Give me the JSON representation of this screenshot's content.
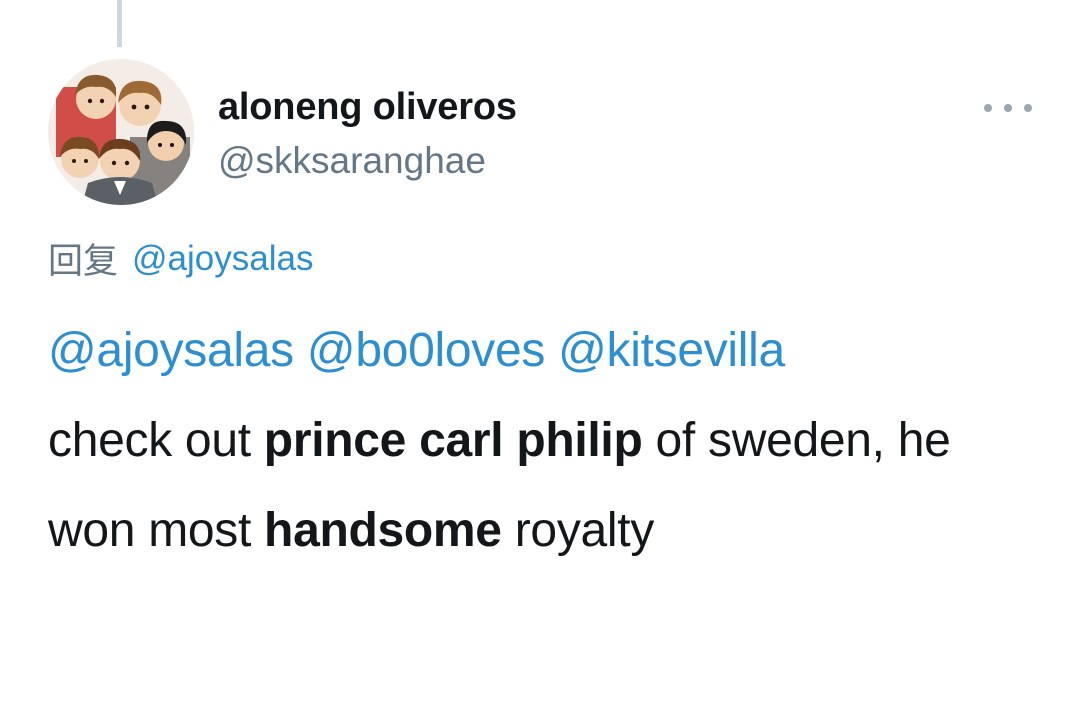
{
  "user": {
    "display_name": "aloneng oliveros",
    "handle": "@skksaranghae"
  },
  "reply": {
    "prefix": "回复",
    "to_handle": "@ajoysalas"
  },
  "tweet": {
    "mentions": [
      "@ajoysalas",
      "@bo0loves",
      "@kitsevilla"
    ],
    "t1": "check out ",
    "b1": "prince carl philip",
    "t2": " of sweden, he won most ",
    "b2": "handsome",
    "t3": " royalty"
  },
  "colors": {
    "link": "#2b8fd1",
    "secondary_text": "#657786",
    "primary_text": "#14171a",
    "thread_line": "#cfd6dc"
  },
  "icons": {
    "more": "more-horizontal-icon"
  }
}
